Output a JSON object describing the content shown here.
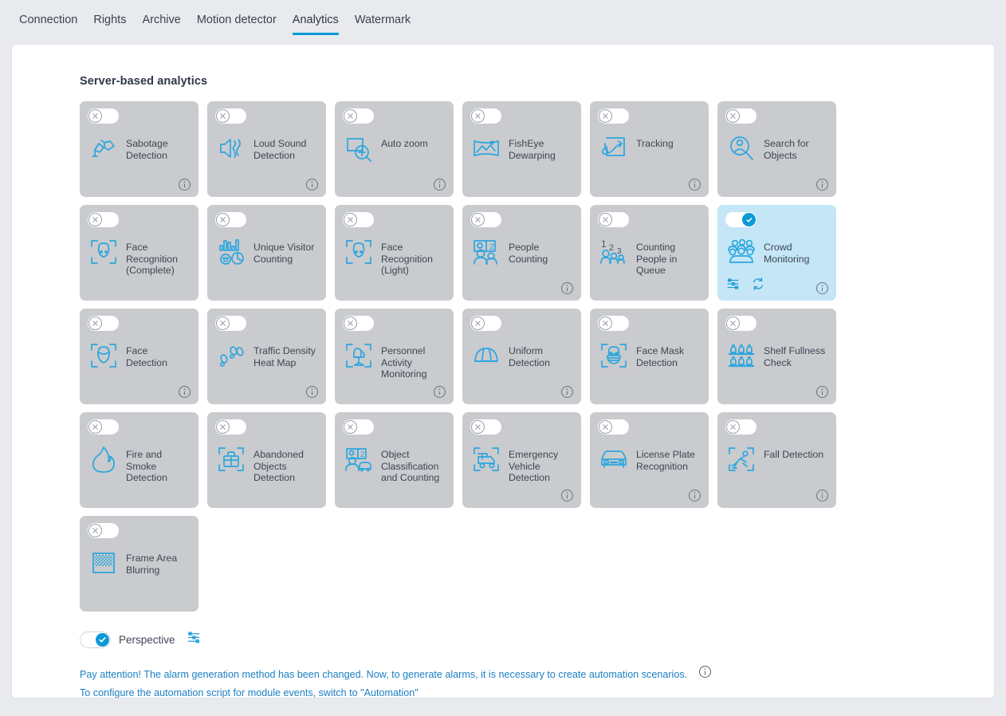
{
  "tabs": [
    {
      "label": "Connection",
      "active": false
    },
    {
      "label": "Rights",
      "active": false
    },
    {
      "label": "Archive",
      "active": false
    },
    {
      "label": "Motion detector",
      "active": false
    },
    {
      "label": "Analytics",
      "active": true
    },
    {
      "label": "Watermark",
      "active": false
    }
  ],
  "section": {
    "title": "Server-based analytics"
  },
  "accent_color": "#0b9ad6",
  "icon_color": "#2ca6de",
  "card_bg": "#c9cbce",
  "card_active_bg": "#c4e6f7",
  "cards": [
    {
      "label": "Sabotage Detection",
      "icon": "sabotage-icon",
      "enabled": false,
      "has_info": true
    },
    {
      "label": "Loud Sound Detection",
      "icon": "loud-sound-icon",
      "enabled": false,
      "has_info": true
    },
    {
      "label": "Auto zoom",
      "icon": "auto-zoom-icon",
      "enabled": false,
      "has_info": true
    },
    {
      "label": "FishEye Dewarping",
      "icon": "fisheye-dewarping-icon",
      "enabled": false,
      "has_info": false
    },
    {
      "label": "Tracking",
      "icon": "tracking-icon",
      "enabled": false,
      "has_info": true
    },
    {
      "label": "Search for Objects",
      "icon": "search-objects-icon",
      "enabled": false,
      "has_info": true
    },
    {
      "label": "Face Recognition (Complete)",
      "icon": "face-recognition-complete-icon",
      "enabled": false,
      "has_info": false
    },
    {
      "label": "Unique Visitor Counting",
      "icon": "unique-visitor-counting-icon",
      "enabled": false,
      "has_info": false
    },
    {
      "label": "Face Recognition (Light)",
      "icon": "face-recognition-light-icon",
      "enabled": false,
      "has_info": false
    },
    {
      "label": "People Counting",
      "icon": "people-counting-icon",
      "enabled": false,
      "has_info": true
    },
    {
      "label": "Counting People in Queue",
      "icon": "counting-people-queue-icon",
      "enabled": false,
      "has_info": false
    },
    {
      "label": "Crowd Monitoring",
      "icon": "crowd-monitoring-icon",
      "enabled": true,
      "has_info": true,
      "has_actions": true
    },
    {
      "label": "Face Detection",
      "icon": "face-detection-icon",
      "enabled": false,
      "has_info": true
    },
    {
      "label": "Traffic Density Heat Map",
      "icon": "traffic-density-heatmap-icon",
      "enabled": false,
      "has_info": true
    },
    {
      "label": "Personnel Activity Monitoring",
      "icon": "personnel-activity-icon",
      "enabled": false,
      "has_info": true
    },
    {
      "label": "Uniform Detection",
      "icon": "uniform-detection-icon",
      "enabled": false,
      "has_info": true
    },
    {
      "label": "Face Mask Detection",
      "icon": "face-mask-detection-icon",
      "enabled": false,
      "has_info": false
    },
    {
      "label": "Shelf Fullness Check",
      "icon": "shelf-fullness-icon",
      "enabled": false,
      "has_info": true
    },
    {
      "label": "Fire and Smoke Detection",
      "icon": "fire-smoke-icon",
      "enabled": false,
      "has_info": false
    },
    {
      "label": "Abandoned Objects Detection",
      "icon": "abandoned-objects-icon",
      "enabled": false,
      "has_info": false
    },
    {
      "label": "Object Classification and Counting",
      "icon": "object-classification-icon",
      "enabled": false,
      "has_info": false
    },
    {
      "label": "Emergency Vehicle Detection",
      "icon": "emergency-vehicle-icon",
      "enabled": false,
      "has_info": true
    },
    {
      "label": "License Plate Recognition",
      "icon": "license-plate-icon",
      "enabled": false,
      "has_info": true
    },
    {
      "label": "Fall Detection",
      "icon": "fall-detection-icon",
      "enabled": false,
      "has_info": true
    },
    {
      "label": "Frame Area Blurring",
      "icon": "frame-area-blurring-icon",
      "enabled": false,
      "has_info": false
    }
  ],
  "perspective": {
    "label": "Perspective",
    "enabled": true,
    "settings_icon": "sliders-icon"
  },
  "notes": {
    "line1": "Pay attention! The alarm generation method has been changed. Now, to generate alarms, it is necessary to create automation scenarios.",
    "line2": "To configure the automation script for module events, switch to \"Automation\""
  }
}
